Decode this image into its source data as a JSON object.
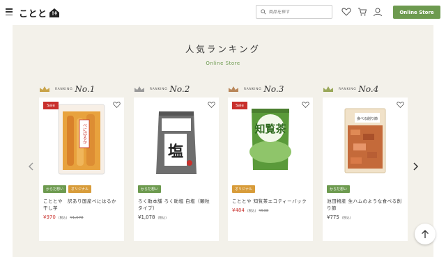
{
  "header": {
    "logo_text": "ことと",
    "search_placeholder": "商品を探す",
    "store_button_label": "Online Store"
  },
  "section": {
    "title": "人気ランキング",
    "subtitle": "Online Store"
  },
  "ranking_label": "RANKING",
  "products": [
    {
      "rank": "No.1",
      "sale": "Sale",
      "tags": [
        {
          "label": "からだ想い",
          "color": "green"
        },
        {
          "label": "オリジナル",
          "color": "orange"
        }
      ],
      "name": "こととや　訳あり国産べにはるか干し芋",
      "price": "¥970",
      "tax": "(税込)",
      "old_price": "¥1,078"
    },
    {
      "rank": "No.2",
      "sale": "",
      "tags": [
        {
          "label": "からだ想い",
          "color": "green"
        }
      ],
      "name": "ろく助本舗 ろく助塩 白塩（顆粒タイプ）",
      "price": "¥1,078",
      "tax": "(税込)",
      "old_price": ""
    },
    {
      "rank": "No.3",
      "sale": "Sale",
      "tags": [
        {
          "label": "オリジナル",
          "color": "orange"
        }
      ],
      "name": "こととや 知覧茶エコティーバック",
      "price": "¥484",
      "tax": "(税込)",
      "old_price": "¥538"
    },
    {
      "rank": "No.4",
      "sale": "",
      "tags": [
        {
          "label": "からだ想い",
          "color": "green"
        }
      ],
      "name": "池田物産 生ハムのような食べる削り節",
      "price": "¥775",
      "tax": "(税込)",
      "old_price": ""
    }
  ],
  "images": {
    "p1_label": "べにはるか",
    "p2_label": "塩",
    "p3_label": "知覧茶",
    "p4_label": "食べる削り節"
  },
  "colors": {
    "accent_green": "#6d9a4f",
    "sale_red": "#c9302c",
    "tag_orange": "#d89c3a",
    "panel_bg": "#f3f1ea"
  }
}
